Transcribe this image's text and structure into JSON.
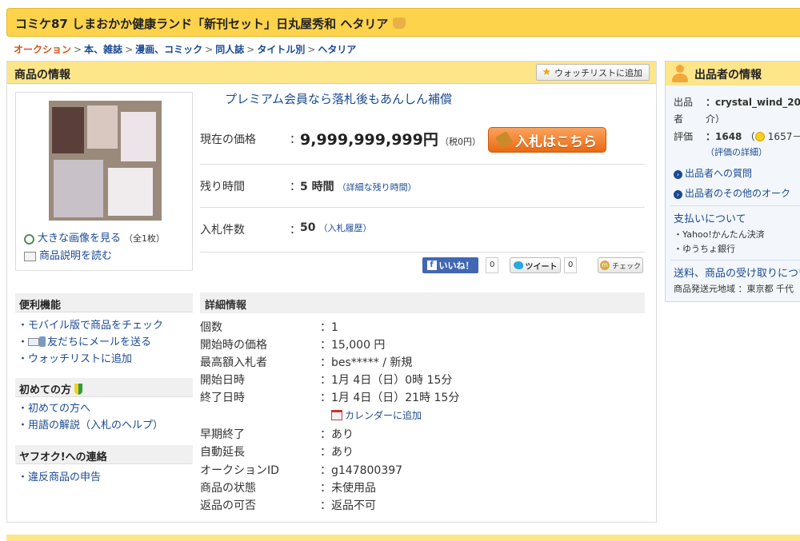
{
  "title": "コミケ87 しまおかか健康ランド「新刊セット」日丸屋秀和 ヘタリア",
  "breadcrumb": [
    "オークション",
    "本、雑誌",
    "漫画、コミック",
    "同人誌",
    "タイトル別",
    "ヘタリア"
  ],
  "item_info": {
    "heading": "商品の情報",
    "watchlist_label": "ウォッチリストに追加",
    "view_large_image": "大きな画像を見る",
    "image_count": "（全1枚）",
    "read_description": "商品説明を読む",
    "premium_notice": "プレミアム会員なら落札後もあんしん補償",
    "price_label": "現在の価格",
    "price_value": "9,999,999,999円",
    "tax_note": "（税0円）",
    "bid_button": "入札はこちら",
    "time_left_label": "残り時間",
    "time_left_value": "5 時間",
    "time_left_detail": "（詳細な残り時間）",
    "bids_label": "入札件数",
    "bids_value": "50",
    "bids_history": "（入札履歴）"
  },
  "social": {
    "like_label": "いいね！",
    "like_count": "0",
    "tweet_label": "ツイート",
    "tweet_count": "0",
    "check_label": "チェック"
  },
  "sidebar": {
    "convenience_heading": "便利機能",
    "convenience_items": [
      "・モバイル版で商品をチェック",
      "友だちにメールを送る",
      "・ウォッチリストに追加"
    ],
    "first_time_heading": "初めての方",
    "first_time_items": [
      "・初めての方へ",
      "・用語の解説（入札のヘルプ）"
    ],
    "contact_heading": "ヤフオク!への連絡",
    "contact_items": [
      "・違反商品の申告"
    ]
  },
  "details": {
    "heading": "詳細情報",
    "rows": [
      {
        "k": "個数",
        "v": "：1"
      },
      {
        "k": "開始時の価格",
        "v": "：15,000 円"
      },
      {
        "k": "最高額入札者",
        "v": "：bes***** / 新規"
      },
      {
        "k": "開始日時",
        "v": "：1月 4日（日）0時 15分"
      },
      {
        "k": "終了日時",
        "v": "：1月 4日（日）21時 15分"
      },
      {
        "k": "早期終了",
        "v": "：あり"
      },
      {
        "k": "自動延長",
        "v": "：あり"
      },
      {
        "k": "オークションID",
        "v": "：g147800397"
      },
      {
        "k": "商品の状態",
        "v": "：未使用品"
      },
      {
        "k": "返品の可否",
        "v": "：返品不可"
      }
    ],
    "calendar_link": "カレンダーに追加"
  },
  "seller": {
    "heading": "出品者の情報",
    "seller_label_1": "出品",
    "seller_label_2": "者",
    "seller_id": "：crystal_wind_20",
    "seller_intro": "介）",
    "rating_label": "評価",
    "rating_value": "：1648",
    "rating_paren": "（",
    "rating_positive": "1657－",
    "rating_detail": "（評価の詳細）",
    "ask_question": "出品者への質問",
    "other_items": "出品者のその他のオーク",
    "payment_heading": "支払いについて",
    "payment_methods": [
      "・Yahoo!かんたん決済",
      "・ゆうちょ銀行"
    ],
    "shipping_heading": "送料、商品の受け取りについ",
    "ship_from": "商品発送元地域 ：東京都 千代"
  }
}
